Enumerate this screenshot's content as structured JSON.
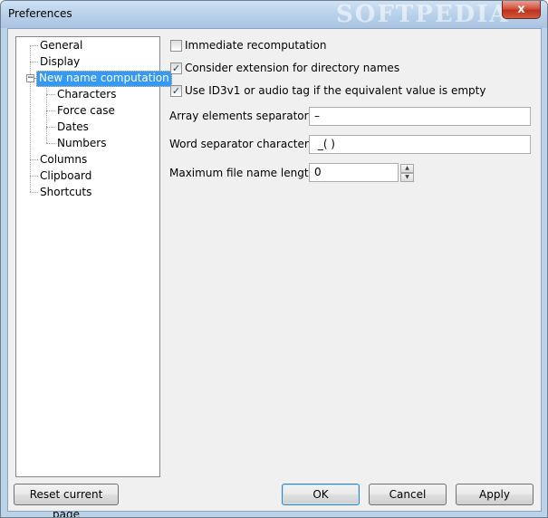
{
  "window": {
    "title": "Preferences",
    "watermark": "SOFTPEDIA",
    "close_glyph": "x"
  },
  "tree": {
    "items": [
      {
        "label": "General"
      },
      {
        "label": "Display"
      },
      {
        "label": "New name computation",
        "selected": true,
        "expanded": true,
        "children": [
          {
            "label": "Characters"
          },
          {
            "label": "Force case"
          },
          {
            "label": "Dates"
          },
          {
            "label": "Numbers"
          }
        ]
      },
      {
        "label": "Columns"
      },
      {
        "label": "Clipboard"
      },
      {
        "label": "Shortcuts"
      }
    ],
    "expander_glyph": "−"
  },
  "options": {
    "immediate_recomputation": {
      "label": "Immediate recomputation",
      "checked": false
    },
    "consider_extension": {
      "label": "Consider extension for directory names",
      "checked": true
    },
    "use_id3v1": {
      "label": "Use ID3v1 or audio tag if the equivalent value is empty",
      "checked": true
    },
    "array_separators": {
      "label": "Array elements separators",
      "value": "–"
    },
    "word_separators": {
      "label": "Word separator characters",
      "value": " _( )"
    },
    "max_length": {
      "label": "Maximum file name length",
      "value": "0"
    },
    "check_glyph": "✓",
    "spin_up_glyph": "▲",
    "spin_down_glyph": "▼"
  },
  "buttons": {
    "reset": "Reset current page",
    "ok": "OK",
    "cancel": "Cancel",
    "apply": "Apply"
  }
}
